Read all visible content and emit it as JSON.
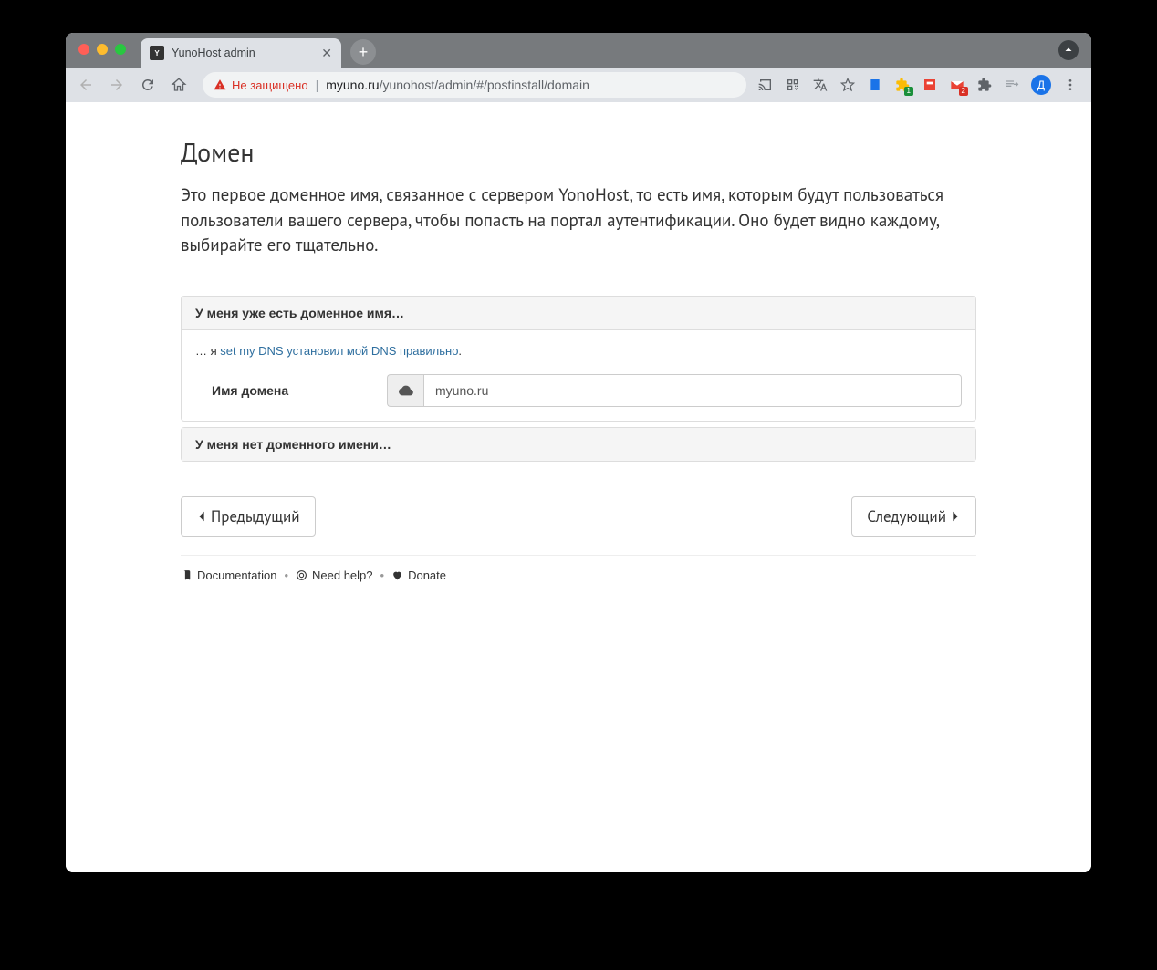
{
  "browser": {
    "tab_title": "YunoHost admin",
    "not_secure_label": "Не защищено",
    "url_host": "myuno.ru",
    "url_path": "/yunohost/admin/#/postinstall/domain",
    "avatar_letter": "Д"
  },
  "page": {
    "heading": "Домен",
    "lead": "Это первое доменное имя, связанное с сервером YonoHost, то есть имя, которым будут пользоваться пользователи вашего сервера, чтобы попасть на портал аутентификации. Оно будет видно каждому, выбирайте его тщательно.",
    "panel_have_domain": "У меня уже есть доменное имя…",
    "hint_prefix": "… я ",
    "hint_link": "set my DNS установил мой DNS правильно",
    "hint_suffix": ".",
    "domain_label": "Имя домена",
    "domain_value": "myuno.ru",
    "panel_no_domain": "У меня нет доменного имени…",
    "prev": "Предыдущий",
    "next": "Следующий"
  },
  "footer": {
    "documentation": "Documentation",
    "help": "Need help?",
    "donate": "Donate"
  }
}
